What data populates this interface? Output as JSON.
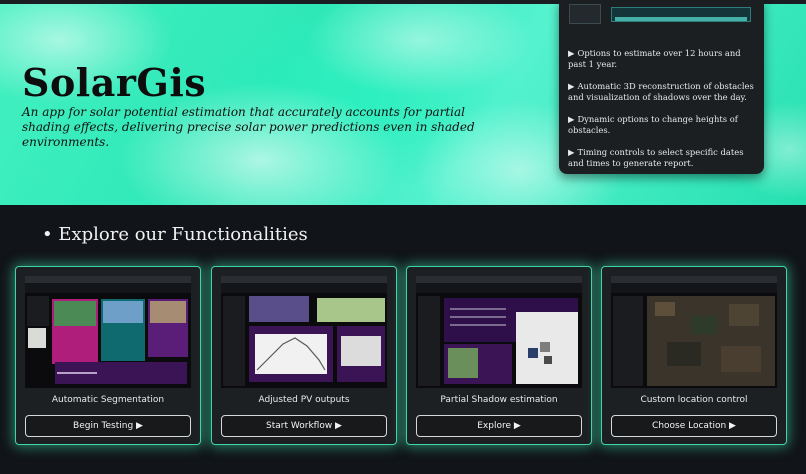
{
  "hero": {
    "title": "SolarGis",
    "subtitle": "An app for solar potential estimation that accurately accounts for partial shading effects, delivering precise solar power predictions even in shaded environments."
  },
  "info_panel": {
    "bullet_glyph": "▶",
    "items": [
      "Options to estimate over 12 hours and past 1 year.",
      "Automatic 3D reconstruction of obstacles and visualization of shadows over the day.",
      "Dynamic options to change heights of obstacles.",
      "Timing controls to select specific dates and times to generate report."
    ]
  },
  "section": {
    "title": "• Explore our Functionalities"
  },
  "cards": [
    {
      "label": "Automatic Segmentation",
      "button": "Begin Testing ▶"
    },
    {
      "label": "Adjusted PV outputs",
      "button": "Start Workflow ▶"
    },
    {
      "label": "Partial Shadow estimation",
      "button": "Explore ▶"
    },
    {
      "label": "Custom location control",
      "button": "Choose Location ▶"
    }
  ],
  "colors": {
    "hero_accent": "#3ef0c4",
    "card_glow": "#3fd6a6",
    "screenshot_purple": "#5b1e78"
  }
}
